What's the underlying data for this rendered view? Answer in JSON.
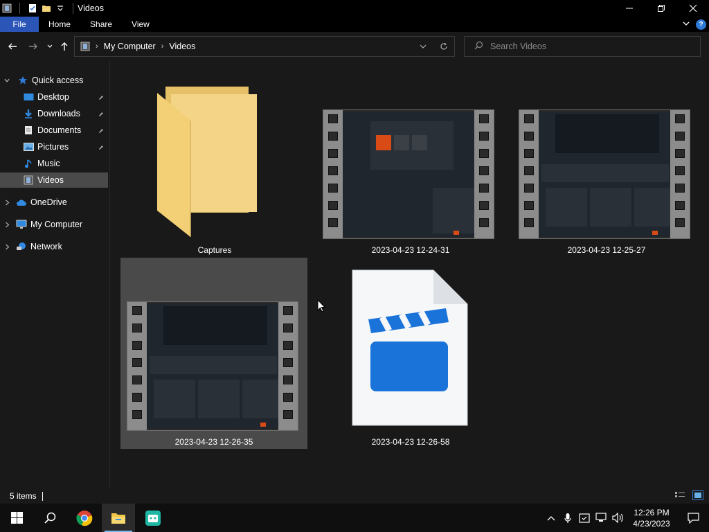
{
  "window": {
    "title": "Videos",
    "minimize_glyph": "—",
    "maximize_glyph": "❐",
    "close_glyph": "✕"
  },
  "ribbon": {
    "tabs": [
      "File",
      "Home",
      "Share",
      "View"
    ],
    "help_glyph": "?"
  },
  "address": {
    "crumbs": [
      "My Computer",
      "Videos"
    ]
  },
  "search": {
    "placeholder": "Search Videos"
  },
  "nav_pane": {
    "quick_access": "Quick access",
    "items": [
      {
        "label": "Desktop",
        "icon": "desktop-icon",
        "pinned": true
      },
      {
        "label": "Downloads",
        "icon": "downloads-icon",
        "pinned": true
      },
      {
        "label": "Documents",
        "icon": "documents-icon",
        "pinned": true
      },
      {
        "label": "Pictures",
        "icon": "pictures-icon",
        "pinned": true
      },
      {
        "label": "Music",
        "icon": "music-icon",
        "pinned": false
      },
      {
        "label": "Videos",
        "icon": "videos-icon",
        "pinned": false,
        "selected": true
      }
    ],
    "onedrive": "OneDrive",
    "my_computer": "My Computer",
    "network": "Network"
  },
  "files": [
    {
      "name": "Captures",
      "type": "folder"
    },
    {
      "name": "2023-04-23 12-24-31",
      "type": "video"
    },
    {
      "name": "2023-04-23 12-25-27",
      "type": "video"
    },
    {
      "name": "2023-04-23 12-26-35",
      "type": "video",
      "selected": true
    },
    {
      "name": "2023-04-23 12-26-58",
      "type": "video-file"
    }
  ],
  "status": {
    "item_count": "5 items"
  },
  "taskbar": {
    "apps": [
      "start-icon",
      "search-icon",
      "chrome-icon",
      "file-explorer-icon",
      "app-icon"
    ],
    "time": "12:26 PM",
    "date": "4/23/2023"
  },
  "colors": {
    "accent": "#2b55b6",
    "selection": "#4a4a4a",
    "background": "#191919",
    "clapper_blue": "#1a73d9"
  }
}
